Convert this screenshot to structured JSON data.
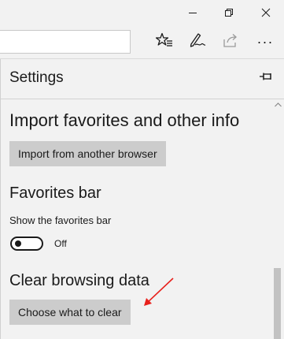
{
  "window": {
    "controls": [
      "minimize-icon",
      "restore-icon",
      "close-icon"
    ]
  },
  "toolbar": {
    "address_value": "",
    "icons": [
      "favorites-star-icon",
      "pen-note-icon",
      "share-icon",
      "more-icon"
    ],
    "more_label": "···"
  },
  "settings": {
    "title": "Settings",
    "pin_icon": "pin-icon",
    "sections": {
      "import": {
        "heading": "Import favorites and other info",
        "button_label": "Import from another browser"
      },
      "favorites_bar": {
        "heading": "Favorites bar",
        "toggle_label": "Show the favorites bar",
        "toggle_state": "Off",
        "toggle_on": false
      },
      "clear_data": {
        "heading": "Clear browsing data",
        "button_label": "Choose what to clear"
      }
    }
  },
  "annotation": {
    "arrow_color": "#e8211c"
  },
  "colors": {
    "background": "#f2f2f2",
    "button": "#cccccc",
    "text": "#1a1a1a"
  }
}
